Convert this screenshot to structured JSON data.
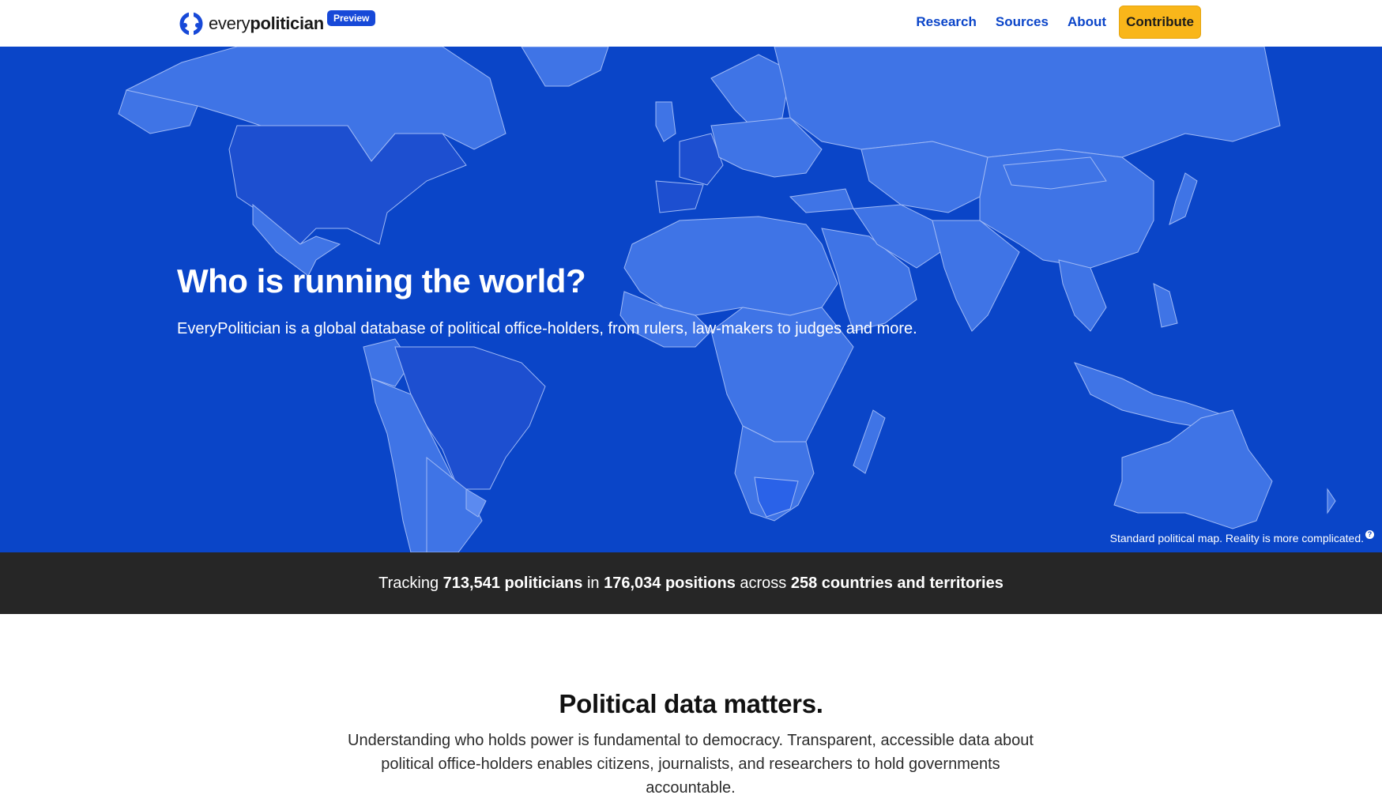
{
  "header": {
    "logo_light": "every",
    "logo_bold": "politician",
    "badge": "Preview",
    "nav": [
      {
        "label": "Research"
      },
      {
        "label": "Sources"
      },
      {
        "label": "About"
      }
    ],
    "cta_label": "Contribute"
  },
  "hero": {
    "title": "Who is running the world?",
    "subtitle": "EveryPolitician is a global database of political office-holders, from rulers, law-makers to judges and more.",
    "map_caption": "Standard political map. Reality is more complicated.",
    "caption_icon": "question-icon"
  },
  "stats": {
    "prefix": "Tracking ",
    "politicians": "713,541 politicians",
    "mid1": " in ",
    "positions": "176,034 positions",
    "mid2": " across ",
    "countries": "258 countries and territories"
  },
  "content": {
    "title": "Political data matters.",
    "body": "Understanding who holds power is fundamental to democracy. Transparent, accessible data about political office-holders enables citizens, journalists, and researchers to hold governments accountable."
  },
  "colors": {
    "hero_bg": "#0a45c8",
    "land": "#3f74e6",
    "land_dark": "#1d4fd0",
    "brand_blue": "#0b45c9",
    "cta_yellow": "#f9b61a",
    "stats_bg": "#262626"
  }
}
